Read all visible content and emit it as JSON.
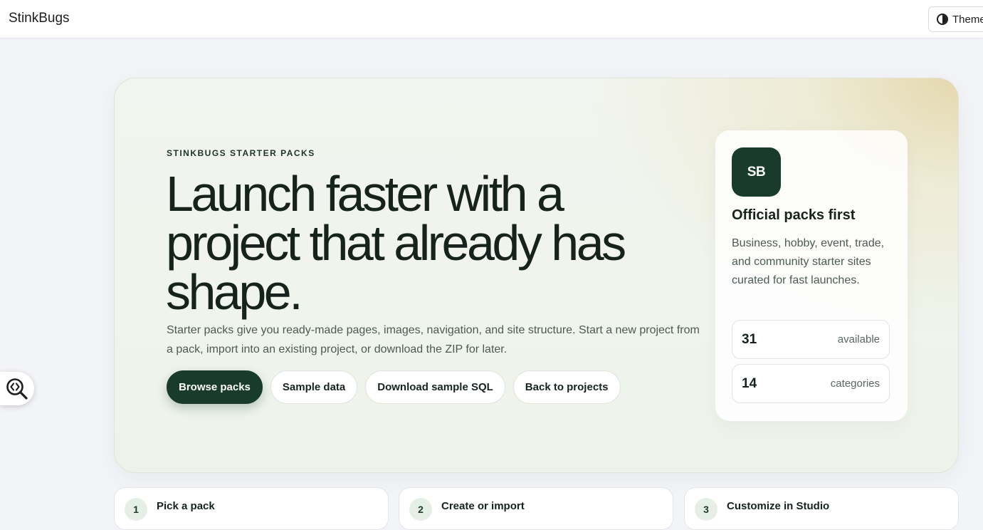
{
  "header": {
    "brand": "StinkBugs",
    "theme_label": "Theme"
  },
  "hero": {
    "eyebrow": "STINKBUGS STARTER PACKS",
    "headline": "Launch faster with a project that already has shape.",
    "lede": "Starter packs give you ready-made pages, images, navigation, and site structure. Start a new project from a pack, import into an existing project, or download the ZIP for later.",
    "actions": {
      "browse": "Browse packs",
      "sample": "Sample data",
      "download_sql": "Download sample SQL",
      "back": "Back to projects"
    }
  },
  "card": {
    "logo": "SB",
    "title": "Official packs first",
    "description": "Business, hobby, event, trade, and community starter sites curated for fast launches.",
    "stats": [
      {
        "value": "31",
        "label": "available"
      },
      {
        "value": "14",
        "label": "categories"
      }
    ]
  },
  "steps": [
    {
      "number": "1",
      "title": "Pick a pack"
    },
    {
      "number": "2",
      "title": "Create or import"
    },
    {
      "number": "3",
      "title": "Customize in Studio"
    }
  ],
  "colors": {
    "accent": "#193b2c",
    "page_bg": "#f3f4f8"
  }
}
